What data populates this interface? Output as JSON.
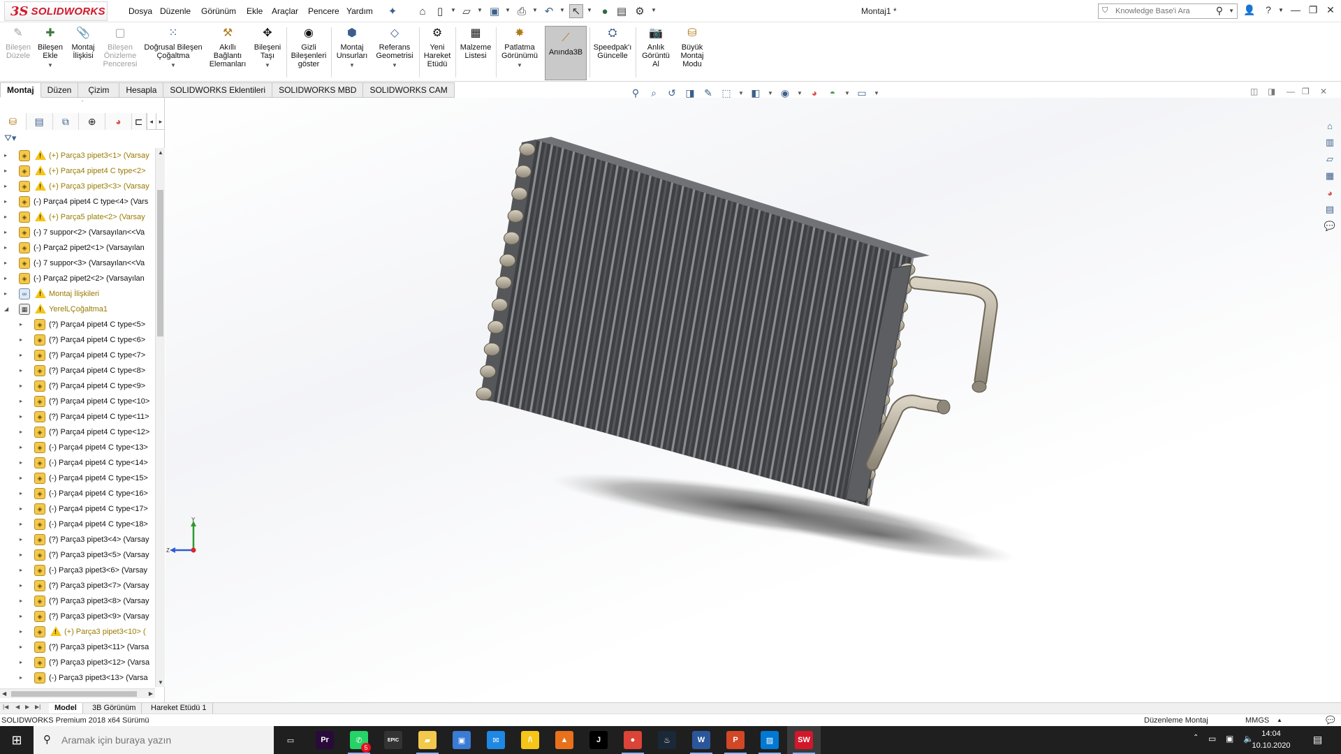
{
  "app": {
    "logo_ds": "3S",
    "logo_text": "SOLIDWORKS",
    "doc_title": "Montaj1 *",
    "menu": [
      "Dosya",
      "Düzenle",
      "Görünüm",
      "Ekle",
      "Araçlar",
      "Pencere",
      "Yardım"
    ],
    "search_placeholder": "Knowledge Base'i Ara",
    "brand_red": "#d3172b"
  },
  "ribbon": {
    "buttons": [
      {
        "id": "bilesen-duzele",
        "label": "Bileşen\nDüzele",
        "icon": "edit-component-icon",
        "disabled": true
      },
      {
        "id": "bilesen-ekle",
        "label": "Bileşen\nEkle",
        "icon": "insert-component-icon",
        "dropdown": true
      },
      {
        "id": "montaj-iliskisi",
        "label": "Montaj\nİlişkisi",
        "icon": "mate-icon"
      },
      {
        "id": "bilesen-onizleme",
        "label": "Bileşen\nÖnizleme\nPenceresi",
        "icon": "preview-window-icon",
        "disabled": true
      },
      {
        "id": "dogrusal-bilesen",
        "label": "Doğrusal Bileşen\nÇoğaltma",
        "icon": "linear-pattern-icon",
        "dropdown": true
      },
      {
        "id": "akilli-baglanti",
        "label": "Akıllı\nBağlantı\nElemanları",
        "icon": "smart-fasteners-icon"
      },
      {
        "id": "bileseni-tasi",
        "label": "Bileşeni\nTaşı",
        "icon": "move-component-icon",
        "dropdown": true
      },
      {
        "id": "gizli-bilesenler",
        "label": "Gizli\nBileşenleri\ngöster",
        "icon": "show-hidden-icon"
      },
      {
        "id": "montaj-unsurlari",
        "label": "Montaj\nUnsurları",
        "icon": "assembly-features-icon",
        "dropdown": true
      },
      {
        "id": "referans-geometrisi",
        "label": "Referans\nGeometrisi",
        "icon": "reference-geometry-icon",
        "dropdown": true
      },
      {
        "id": "yeni-hareket",
        "label": "Yeni\nHareket\nEtüdü",
        "icon": "motion-study-icon"
      },
      {
        "id": "malzeme-listesi",
        "label": "Malzeme\nListesi",
        "icon": "bom-icon"
      },
      {
        "id": "patlatma",
        "label": "Patlatma\nGörünümü",
        "icon": "exploded-view-icon",
        "dropdown": true
      },
      {
        "id": "aninda3b",
        "label": "Anında3B",
        "icon": "instant3d-icon",
        "active": true
      },
      {
        "id": "speedpak",
        "label": "Speedpak'ı\nGüncelle",
        "icon": "speedpak-icon"
      },
      {
        "id": "anlik-goruntu",
        "label": "Anlık\nGörüntü\nAl",
        "icon": "snapshot-icon"
      },
      {
        "id": "buyuk-montaj",
        "label": "Büyük\nMontaj\nModu",
        "icon": "large-assembly-icon"
      }
    ]
  },
  "command_tabs": [
    "Montaj",
    "Düzen",
    "Çizim",
    "Hesapla",
    "SOLIDWORKS Eklentileri",
    "SOLIDWORKS MBD",
    "SOLIDWORKS CAM"
  ],
  "tree": {
    "items": [
      {
        "label": "(+) Parça3 pipet3<1> (Varsay",
        "warn": true,
        "depth": 0,
        "kind": "part"
      },
      {
        "label": "(+) Parça4 pipet4 C type<2>",
        "warn": true,
        "depth": 0,
        "kind": "part"
      },
      {
        "label": "(+) Parça3 pipet3<3> (Varsay",
        "warn": true,
        "depth": 0,
        "kind": "part"
      },
      {
        "label": "(-) Parça4 pipet4 C type<4> (Vars",
        "warn": false,
        "depth": 0,
        "kind": "part"
      },
      {
        "label": "(+) Parça5  plate<2> (Varsay",
        "warn": true,
        "depth": 0,
        "kind": "part"
      },
      {
        "label": "(-) 7 suppor<2> (Varsayılan<<Va",
        "warn": false,
        "depth": 0,
        "kind": "part"
      },
      {
        "label": "(-) Parça2 pipet2<1> (Varsayılan",
        "warn": false,
        "depth": 0,
        "kind": "part"
      },
      {
        "label": "(-) 7 suppor<3> (Varsayılan<<Va",
        "warn": false,
        "depth": 0,
        "kind": "part"
      },
      {
        "label": "(-) Parça2 pipet2<2> (Varsayılan",
        "warn": false,
        "depth": 0,
        "kind": "part"
      },
      {
        "label": "Montaj İlişkileri",
        "warn": true,
        "depth": 0,
        "kind": "mates"
      },
      {
        "label": "YerelLÇoğaltma1",
        "warn": true,
        "depth": 0,
        "kind": "pattern",
        "expanded": true
      },
      {
        "label": "(?) Parça4 pipet4 C type<5>",
        "warn": false,
        "depth": 1,
        "kind": "part"
      },
      {
        "label": "(?) Parça4 pipet4 C type<6>",
        "warn": false,
        "depth": 1,
        "kind": "part"
      },
      {
        "label": "(?) Parça4 pipet4 C type<7>",
        "warn": false,
        "depth": 1,
        "kind": "part"
      },
      {
        "label": "(?) Parça4 pipet4 C type<8>",
        "warn": false,
        "depth": 1,
        "kind": "part"
      },
      {
        "label": "(?) Parça4 pipet4 C type<9>",
        "warn": false,
        "depth": 1,
        "kind": "part"
      },
      {
        "label": "(?) Parça4 pipet4 C type<10>",
        "warn": false,
        "depth": 1,
        "kind": "part"
      },
      {
        "label": "(?) Parça4 pipet4 C type<11>",
        "warn": false,
        "depth": 1,
        "kind": "part"
      },
      {
        "label": "(?) Parça4 pipet4 C type<12>",
        "warn": false,
        "depth": 1,
        "kind": "part"
      },
      {
        "label": "(-) Parça4 pipet4 C type<13>",
        "warn": false,
        "depth": 1,
        "kind": "part"
      },
      {
        "label": "(-) Parça4 pipet4 C type<14>",
        "warn": false,
        "depth": 1,
        "kind": "part"
      },
      {
        "label": "(-) Parça4 pipet4 C type<15>",
        "warn": false,
        "depth": 1,
        "kind": "part"
      },
      {
        "label": "(-) Parça4 pipet4 C type<16>",
        "warn": false,
        "depth": 1,
        "kind": "part"
      },
      {
        "label": "(-) Parça4 pipet4 C type<17>",
        "warn": false,
        "depth": 1,
        "kind": "part"
      },
      {
        "label": "(-) Parça4 pipet4 C type<18>",
        "warn": false,
        "depth": 1,
        "kind": "part"
      },
      {
        "label": "(?) Parça3 pipet3<4> (Varsay",
        "warn": false,
        "depth": 1,
        "kind": "part"
      },
      {
        "label": "(?) Parça3 pipet3<5> (Varsay",
        "warn": false,
        "depth": 1,
        "kind": "part"
      },
      {
        "label": "(-) Parça3 pipet3<6> (Varsay",
        "warn": false,
        "depth": 1,
        "kind": "part"
      },
      {
        "label": "(?) Parça3 pipet3<7> (Varsay",
        "warn": false,
        "depth": 1,
        "kind": "part"
      },
      {
        "label": "(?) Parça3 pipet3<8> (Varsay",
        "warn": false,
        "depth": 1,
        "kind": "part"
      },
      {
        "label": "(?) Parça3 pipet3<9> (Varsay",
        "warn": false,
        "depth": 1,
        "kind": "part"
      },
      {
        "label": "(+) Parça3 pipet3<10> (",
        "warn": true,
        "depth": 1,
        "kind": "part"
      },
      {
        "label": "(?) Parça3 pipet3<11> (Varsa",
        "warn": false,
        "depth": 1,
        "kind": "part"
      },
      {
        "label": "(?) Parça3 pipet3<12> (Varsa",
        "warn": false,
        "depth": 1,
        "kind": "part"
      },
      {
        "label": "(-) Parça3 pipet3<13> (Varsa",
        "warn": false,
        "depth": 1,
        "kind": "part"
      }
    ]
  },
  "triad": {
    "y": "Y",
    "z": "Z"
  },
  "bottom_tabs": [
    "Model",
    "3B Görünüm",
    "Hareket Etüdü 1"
  ],
  "status": {
    "version": "SOLIDWORKS Premium 2018 x64 Sürümü",
    "mode": "Düzenleme Montaj",
    "units": "MMGS"
  },
  "taskbar": {
    "search_placeholder": "Aramak için buraya yazın",
    "time": "14:04",
    "date": "10.10.2020",
    "whatsapp_badge": "5",
    "apps": [
      {
        "name": "task-view",
        "glyph": "▭",
        "color": "#1f1f1f"
      },
      {
        "name": "premiere",
        "glyph": "Pr",
        "color": "#2a0a3a"
      },
      {
        "name": "whatsapp",
        "glyph": "✆",
        "color": "#25d366"
      },
      {
        "name": "epic-games",
        "glyph": "EPIC",
        "color": "#333333"
      },
      {
        "name": "file-explorer",
        "glyph": "▰",
        "color": "#f2c94c"
      },
      {
        "name": "store",
        "glyph": "▣",
        "color": "#3a7bd5"
      },
      {
        "name": "mail",
        "glyph": "✉",
        "color": "#1e88e5"
      },
      {
        "name": "archicad",
        "glyph": "/\\",
        "color": "#f5c518"
      },
      {
        "name": "matlab",
        "glyph": "▲",
        "color": "#e8711b"
      },
      {
        "name": "jetbrains",
        "glyph": "J",
        "color": "#000000"
      },
      {
        "name": "chrome",
        "glyph": "●",
        "color": "#db4437"
      },
      {
        "name": "steam",
        "glyph": "♨",
        "color": "#1b2838"
      },
      {
        "name": "word",
        "glyph": "W",
        "color": "#2b579a"
      },
      {
        "name": "powerpoint",
        "glyph": "P",
        "color": "#d24726"
      },
      {
        "name": "photos",
        "glyph": "▨",
        "color": "#0078d4"
      },
      {
        "name": "solidworks",
        "glyph": "SW",
        "color": "#d3172b"
      }
    ]
  }
}
